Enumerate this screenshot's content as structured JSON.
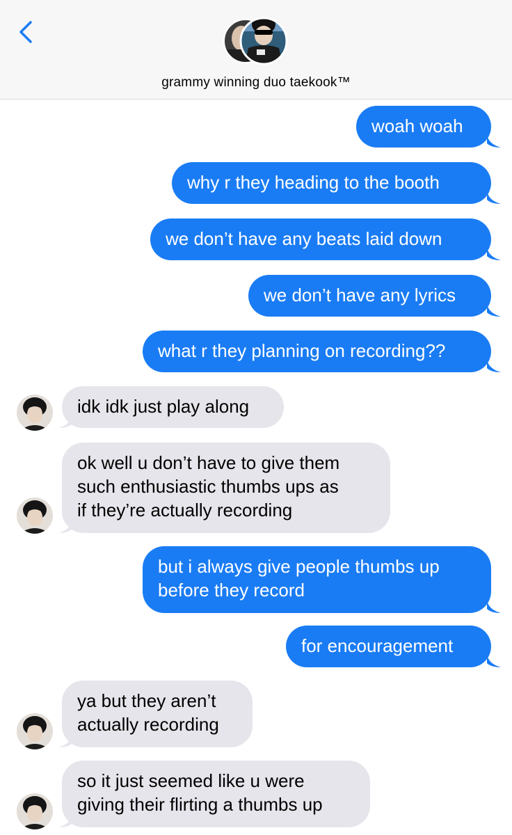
{
  "header": {
    "contact_name": "grammy winning duo taekook™",
    "back_icon": "chevron-left-icon",
    "accent_color": "#1a7cf4"
  },
  "messages": [
    {
      "side": "sent",
      "text": "woah woah"
    },
    {
      "side": "sent",
      "text": "why r they heading to the booth"
    },
    {
      "side": "sent",
      "text": "we don’t have any beats laid down"
    },
    {
      "side": "sent",
      "text": "we don’t have any lyrics"
    },
    {
      "side": "sent",
      "text": "what r they planning on recording??"
    },
    {
      "side": "received",
      "text": "idk idk just play along"
    },
    {
      "side": "received",
      "text": "ok well u don’t have to give them\nsuch enthusiastic thumbs ups as\nif they’re actually recording"
    },
    {
      "side": "sent",
      "text": "but i always give people thumbs up\nbefore they record"
    },
    {
      "side": "sent",
      "text": "for encouragement"
    },
    {
      "side": "received",
      "text": "ya but they aren’t\nactually recording"
    },
    {
      "side": "received",
      "text": "so it just seemed like u were\ngiving their flirting a thumbs up"
    }
  ],
  "colors": {
    "sent_bubble": "#1a7cf4",
    "received_bubble": "#e6e5eb",
    "header_bg": "#f7f7f7"
  }
}
